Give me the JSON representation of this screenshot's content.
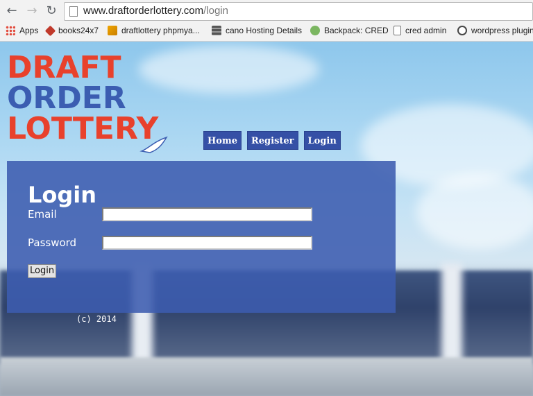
{
  "browser": {
    "url_host": "www.draftorderlottery.com",
    "url_path": "/login",
    "back_glyph": "←",
    "forward_glyph": "→",
    "reload_glyph": "↻",
    "bookmarks": [
      {
        "label": "Apps",
        "icon": "apps-grid-icon",
        "color": "#e24a3b"
      },
      {
        "label": "books24x7",
        "icon": "books24x7-icon",
        "color": "#c0392b"
      },
      {
        "label": "draftlottery phpmya...",
        "icon": "phpmyadmin-icon",
        "color": "#f0a500"
      },
      {
        "label": "cano Hosting Details",
        "icon": "server-icon",
        "color": "#555555"
      },
      {
        "label": "Backpack: CRED",
        "icon": "backpack-icon",
        "color": "#7bb661"
      },
      {
        "label": "cred admin",
        "icon": "page-icon",
        "color": "#ffffff"
      },
      {
        "label": "wordpress plugin",
        "icon": "wordpress-icon",
        "color": "#464646"
      }
    ]
  },
  "logo": {
    "line1": "DRAFT",
    "line2": "ORDER",
    "line3": "LOTTERY",
    "colors": {
      "red": "#e8412c",
      "blue": "#3b5db1"
    }
  },
  "menu": {
    "home": "Home",
    "register": "Register",
    "login": "Login"
  },
  "form": {
    "title": "Login",
    "email_label": "Email",
    "email_value": "",
    "password_label": "Password",
    "password_value": "",
    "submit_label": "Login"
  },
  "footer": {
    "copyright": "(c) 2014"
  }
}
